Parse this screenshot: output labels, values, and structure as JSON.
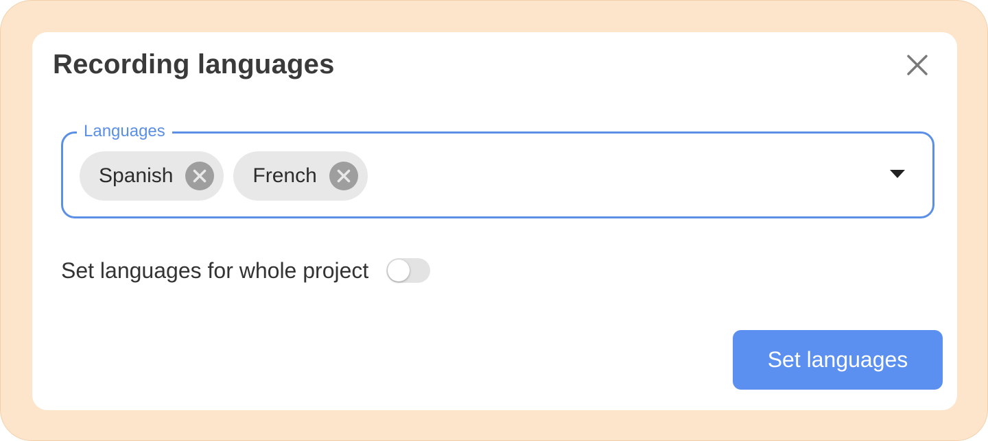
{
  "dialog": {
    "title": "Recording languages"
  },
  "languages_field": {
    "label": "Languages",
    "selected": [
      {
        "label": "Spanish"
      },
      {
        "label": "French"
      }
    ]
  },
  "whole_project": {
    "label": "Set languages for whole project",
    "enabled": false
  },
  "actions": {
    "submit_label": "Set languages"
  },
  "colors": {
    "accent": "#5b8fe6",
    "button": "#5b8ff0",
    "frame": "#fde5cb",
    "chip_bg": "#e8e8e8",
    "chip_remove": "#9e9e9e"
  },
  "icons": {
    "close": "close-icon",
    "chip_remove": "remove-circle-icon",
    "dropdown": "caret-down-icon"
  }
}
